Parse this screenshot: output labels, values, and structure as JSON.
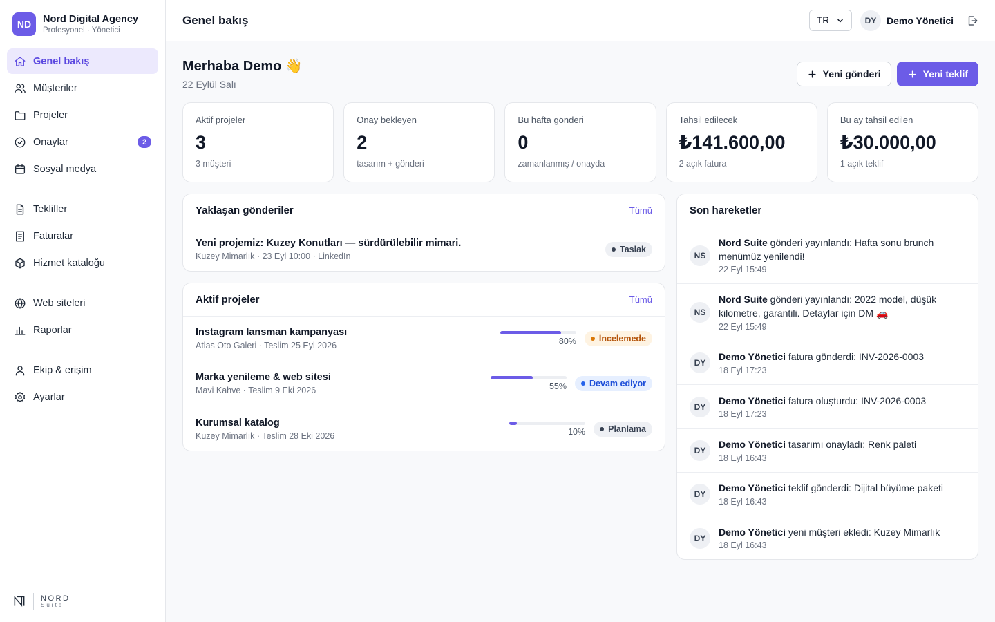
{
  "sidebar": {
    "brand": {
      "initials": "ND",
      "name": "Nord Digital Agency",
      "subtitle": "Profesyonel · Yönetici"
    },
    "items": [
      {
        "label": "Genel bakış",
        "icon": "home-icon",
        "active": true
      },
      {
        "label": "Müşteriler",
        "icon": "users-icon"
      },
      {
        "label": "Projeler",
        "icon": "folder-icon"
      },
      {
        "label": "Onaylar",
        "icon": "check-circle-icon",
        "badge": "2"
      },
      {
        "label": "Sosyal medya",
        "icon": "calendar-icon"
      },
      {
        "label": "Teklifler",
        "icon": "document-icon"
      },
      {
        "label": "Faturalar",
        "icon": "receipt-icon"
      },
      {
        "label": "Hizmet kataloğu",
        "icon": "box-icon"
      },
      {
        "label": "Web siteleri",
        "icon": "globe-icon"
      },
      {
        "label": "Raporlar",
        "icon": "chart-icon"
      },
      {
        "label": "Ekip & erişim",
        "icon": "user-icon"
      },
      {
        "label": "Ayarlar",
        "icon": "gear-icon"
      }
    ],
    "footer": {
      "word": "NORD",
      "sub": "Suite"
    }
  },
  "topbar": {
    "title": "Genel bakış",
    "language": "TR",
    "user_initials": "DY",
    "user_name": "Demo Yönetici"
  },
  "greeting": {
    "title": "Merhaba Demo 👋",
    "date": "22 Eylül Salı"
  },
  "actions": {
    "new_post": "Yeni gönderi",
    "new_offer": "Yeni teklif"
  },
  "stats": [
    {
      "label": "Aktif projeler",
      "value": "3",
      "sub": "3 müşteri"
    },
    {
      "label": "Onay bekleyen",
      "value": "2",
      "sub": "tasarım + gönderi"
    },
    {
      "label": "Bu hafta gönderi",
      "value": "0",
      "sub": "zamanlanmış / onayda"
    },
    {
      "label": "Tahsil edilecek",
      "value": "₺141.600,00",
      "sub": "2 açık fatura"
    },
    {
      "label": "Bu ay tahsil edilen",
      "value": "₺30.000,00",
      "sub": "1 açık teklif"
    }
  ],
  "upcoming": {
    "title": "Yaklaşan gönderiler",
    "link": "Tümü",
    "items": [
      {
        "title": "Yeni projemiz: Kuzey Konutları — sürdürülebilir mimari.",
        "meta": "Kuzey Mimarlık · 23 Eyl 10:00 · LinkedIn",
        "status": "Taslak"
      }
    ]
  },
  "projects": {
    "title": "Aktif projeler",
    "link": "Tümü",
    "items": [
      {
        "title": "Instagram lansman kampanyası",
        "meta": "Atlas Oto Galeri · Teslim 25 Eyl 2026",
        "progress": 0.8,
        "pct": "80%",
        "status": "İncelemede",
        "tone": "amber"
      },
      {
        "title": "Marka yenileme & web sitesi",
        "meta": "Mavi Kahve · Teslim 9 Eki 2026",
        "progress": 0.55,
        "pct": "55%",
        "status": "Devam ediyor",
        "tone": "blue"
      },
      {
        "title": "Kurumsal katalog",
        "meta": "Kuzey Mimarlık · Teslim 28 Eki 2026",
        "progress": 0.1,
        "pct": "10%",
        "status": "Planlama",
        "tone": "gray"
      }
    ]
  },
  "activity": {
    "title": "Son hareketler",
    "items": [
      {
        "initials": "NS",
        "actor": "Nord Suite",
        "text": " gönderi yayınlandı: Hafta sonu brunch menümüz yenilendi!",
        "time": "22 Eyl 15:49"
      },
      {
        "initials": "NS",
        "actor": "Nord Suite",
        "text": " gönderi yayınlandı: 2022 model, düşük kilometre, garantili. Detaylar için DM 🚗",
        "time": "22 Eyl 15:49"
      },
      {
        "initials": "DY",
        "actor": "Demo Yönetici",
        "text": " fatura gönderdi: INV-2026-0003",
        "time": "18 Eyl 17:23"
      },
      {
        "initials": "DY",
        "actor": "Demo Yönetici",
        "text": " fatura oluşturdu: INV-2026-0003",
        "time": "18 Eyl 17:23"
      },
      {
        "initials": "DY",
        "actor": "Demo Yönetici",
        "text": " tasarımı onayladı: Renk paleti",
        "time": "18 Eyl 16:43"
      },
      {
        "initials": "DY",
        "actor": "Demo Yönetici",
        "text": " teklif gönderdi: Dijital büyüme paketi",
        "time": "18 Eyl 16:43"
      },
      {
        "initials": "DY",
        "actor": "Demo Yönetici",
        "text": " yeni müşteri ekledi: Kuzey Mimarlık",
        "time": "18 Eyl 16:43"
      }
    ]
  },
  "colors": {
    "accent": "#6c5ce7",
    "amber": "#b45309",
    "blue": "#1d4ed8"
  }
}
